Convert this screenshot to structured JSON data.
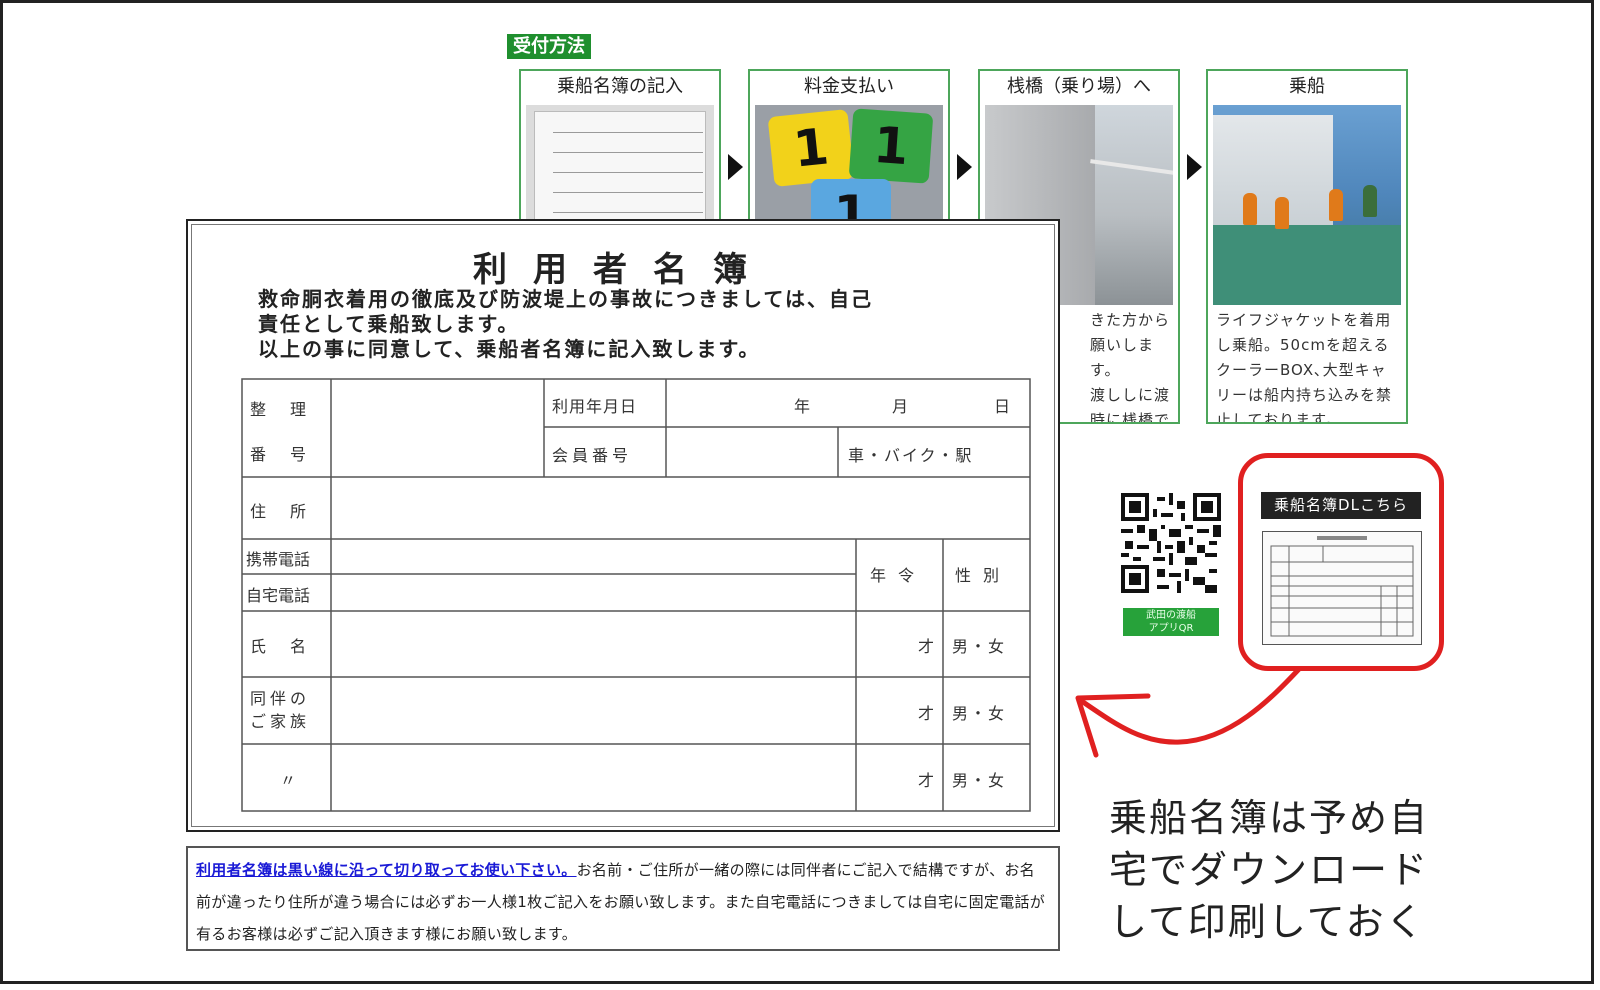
{
  "reception": {
    "label": "受付方法",
    "steps": [
      {
        "title": "乗船名簿の記入",
        "text": ""
      },
      {
        "title": "料金支払い",
        "text": "",
        "ticket_numbers": [
          "1",
          "1",
          "1"
        ]
      },
      {
        "title": "桟橋（乗り場）へ",
        "text": "きた方から\n願いします。\n渡ししに渡\n時に桟橋で\n釣り場まで\nい。"
      },
      {
        "title": "乗船",
        "text": "ライフジャケットを着用\nし乗船。50cmを超える\nクーラーBOX､大型キャ\nリーは船内持ち込みを禁\n止しております。"
      }
    ]
  },
  "form": {
    "title": "利用者名簿",
    "intro": [
      "救命胴衣着用の徹底及び防波堤上の事故につきましては、自己",
      "責任として乗船致します。",
      "以上の事に同意して、乗船者名簿に記入致します。"
    ],
    "cells": {
      "seiri": "整　理",
      "bango": "番　号",
      "riyou_date": "利用年月日",
      "nen": "年",
      "gatsu": "月",
      "nichi": "日",
      "kaiin": "会員番号",
      "transport": "車・バイク・駅",
      "address": "住　所",
      "mobile": "携帯電話",
      "home": "自宅電話",
      "age": "年令",
      "sex": "性別",
      "name": "氏　名",
      "family": "同伴の\nご家族",
      "ditto": "〃",
      "sai": "才",
      "mf": "男・女"
    }
  },
  "note": {
    "link": "利用者名簿は黒い線に沿って切り取ってお使い下さい。",
    "text": "お名前・ご住所が一緒の際には同伴者にご記入で結構ですが、お名前が違ったり住所が違う場合には必ずお一人様1枚ご記入をお願い致します。また自宅電話につきましては自宅に固定電話が有るお客様は必ずご記入頂きます様にお願い致します。"
  },
  "qr_label": "武田の渡船\nアプリQR",
  "download": {
    "button": "乗船名簿DLこちら"
  },
  "big_note": "乗船名簿は予め自宅でダウンロードして印刷しておく",
  "colors": {
    "green": "#1f8f2e",
    "red": "#e02020",
    "link_blue": "#1a1ad6"
  }
}
